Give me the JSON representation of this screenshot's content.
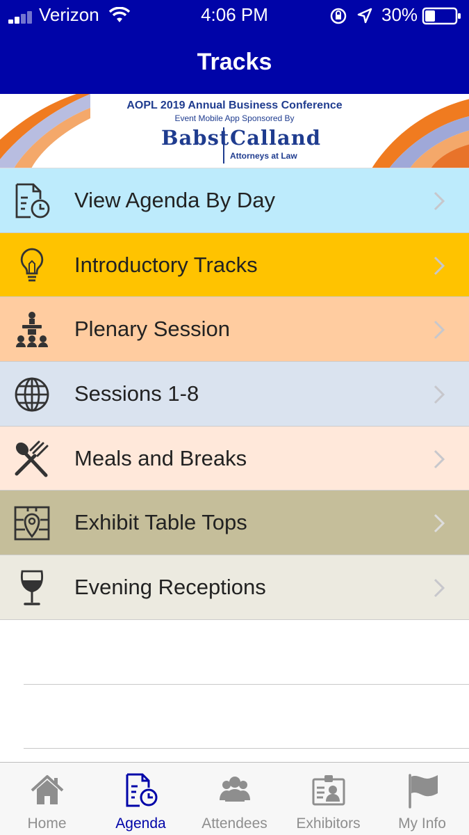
{
  "status_bar": {
    "carrier": "Verizon",
    "time": "4:06 PM",
    "battery": "30%"
  },
  "header": {
    "title": "Tracks"
  },
  "banner": {
    "conference_title": "AOPL 2019 Annual  Business Conference",
    "sponsor_line": "Event Mobile App Sponsored By",
    "firm_name_left": "Babst",
    "firm_name_right": "Calland",
    "firm_subtitle": "Attorneys at Law"
  },
  "tracks": [
    {
      "label": "View Agenda By Day",
      "icon": "agenda-clock-icon",
      "color": "#BDEBFC"
    },
    {
      "label": "Introductory Tracks",
      "icon": "lightbulb-icon",
      "color": "#FFC300"
    },
    {
      "label": "Plenary Session",
      "icon": "podium-audience-icon",
      "color": "#FFCCA0"
    },
    {
      "label": "Sessions 1-8",
      "icon": "globe-icon",
      "color": "#DAE3EF"
    },
    {
      "label": "Meals and Breaks",
      "icon": "fork-spoon-icon",
      "color": "#FFE8DA"
    },
    {
      "label": "Exhibit Table Tops",
      "icon": "map-pin-icon",
      "color": "#C5BE9A"
    },
    {
      "label": "Evening Receptions",
      "icon": "wine-glass-icon",
      "color": "#ECEAE0"
    }
  ],
  "tab_bar": {
    "active": "Agenda",
    "tabs": [
      {
        "label": "Home",
        "icon": "home-icon"
      },
      {
        "label": "Agenda",
        "icon": "agenda-clock-icon"
      },
      {
        "label": "Attendees",
        "icon": "people-icon"
      },
      {
        "label": "Exhibitors",
        "icon": "badge-icon"
      },
      {
        "label": "My Info",
        "icon": "flag-icon"
      }
    ]
  },
  "colors": {
    "header": "#0004A8",
    "active_tab": "#0004A8",
    "inactive_tab": "#8E8E8E",
    "banner_text": "#1F3C8F"
  }
}
